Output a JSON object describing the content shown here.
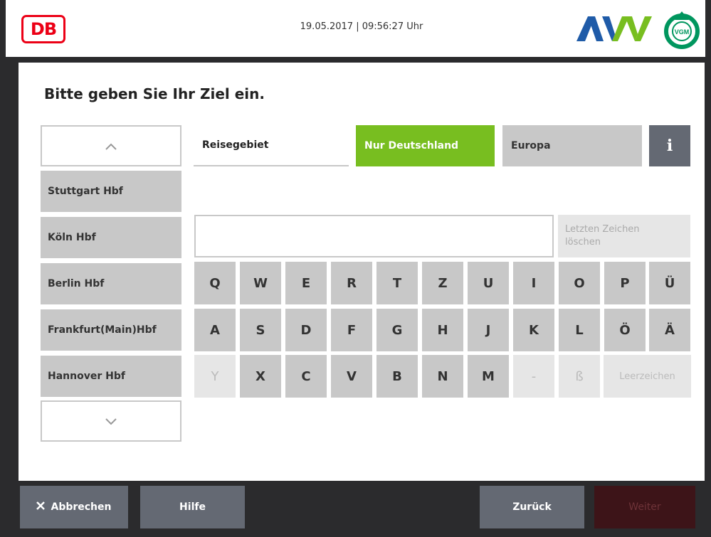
{
  "header": {
    "db_logo": "DB",
    "datetime": "19.05.2017 | 09:56:27 Uhr",
    "avv_logo": "AVV",
    "vgm_logo": "VGM",
    "colors": {
      "db_red": "#ec0016",
      "avv_blue": "#1f5ba8",
      "avv_green": "#78be20"
    }
  },
  "prompt": "Bitte geben Sie Ihr Ziel ein.",
  "destinations": {
    "scroll_up_icon": "chevron-up-icon",
    "scroll_down_icon": "chevron-down-icon",
    "items": [
      "Stuttgart Hbf",
      "Köln Hbf",
      "Berlin Hbf",
      "Frankfurt(Main)Hbf",
      "Hannover Hbf"
    ]
  },
  "region": {
    "label": "Reisegebiet",
    "options": [
      "Nur Deutschland",
      "Europa"
    ],
    "selected": "Nur Deutschland",
    "info_label": "i"
  },
  "input": {
    "value": "",
    "placeholder": ""
  },
  "delete_button": {
    "line1": "Letzten Zeichen",
    "line2": "löschen"
  },
  "keyboard": {
    "row1": [
      "Q",
      "W",
      "E",
      "R",
      "T",
      "Z",
      "U",
      "I",
      "O",
      "P",
      "Ü"
    ],
    "row2": [
      "A",
      "S",
      "D",
      "F",
      "G",
      "H",
      "J",
      "K",
      "L",
      "Ö",
      "Ä"
    ],
    "row3": [
      "Y",
      "X",
      "C",
      "V",
      "B",
      "N",
      "M",
      "-",
      "ß"
    ],
    "row3_disabled": [
      "Y",
      "-",
      "ß"
    ],
    "space_label": "Leerzeichen"
  },
  "footer": {
    "cancel_label": "Abbrechen",
    "cancel_icon": "close-icon",
    "help_label": "Hilfe",
    "back_label": "Zurück",
    "next_label": "Weiter"
  },
  "colors": {
    "accent_green": "#78be20",
    "button_gray": "#646973",
    "key_gray": "#c8c8c8",
    "next_disabled": "#3d1418"
  }
}
